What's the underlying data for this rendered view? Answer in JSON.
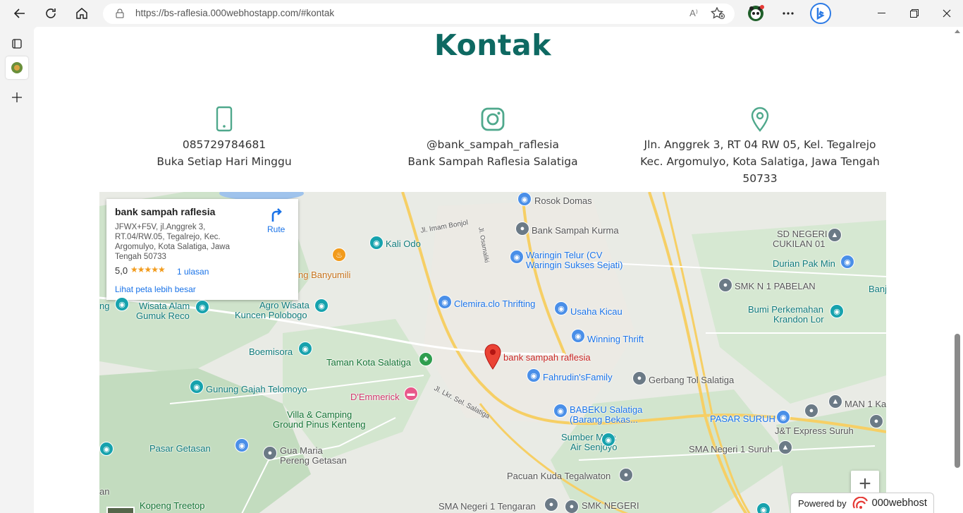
{
  "browser": {
    "url": "https://bs-raflesia.000webhostapp.com/#kontak",
    "read_aloud_label": "A⁾"
  },
  "page": {
    "title": "Kontak",
    "contacts": [
      {
        "icon": "phone-icon",
        "line1": "085729784681",
        "line2": "Buka Setiap Hari Minggu"
      },
      {
        "icon": "instagram-icon",
        "line1": "@bank_sampah_raflesia",
        "line2": "Bank Sampah Raflesia Salatiga"
      },
      {
        "icon": "location-pin-icon",
        "line1": "Jln. Anggrek 3, RT 04 RW 05, Kel. Tegalrejo",
        "line2": "Kec. Argomulyo, Kota Salatiga, Jawa Tengah 50733"
      }
    ],
    "accent_color": "#0e6962",
    "icon_color": "#4fa88c"
  },
  "map": {
    "card": {
      "name": "bank sampah raflesia",
      "address": "JFWX+F5V, jl.Anggrek 3, RT.04/RW.05, Tegalrejo, Kec. Argomulyo, Kota Salatiga, Jawa Tengah 50733",
      "rating": "5,0",
      "stars": "★★★★★",
      "reviews": "1 ulasan",
      "larger_map": "Lihat peta lebih besar",
      "directions": "Rute"
    },
    "marker_label": "bank sampah raflesia",
    "places": {
      "rosok_domas": "Rosok Domas",
      "bank_sampah_kurma": "Bank Sampah Kurma",
      "jl_imam_bonjol": "Jl. Imam Bonjol",
      "kali_odo": "Kali Odo",
      "waringin_telur_1": "Waringin Telur (CV",
      "waringin_telur_2": "Waringin Sukses Sejati)",
      "sd_negeri_1": "SD NEGERI",
      "sd_negeri_2": "CUKILAN 01",
      "durian_pak_min": "Durian Pak Min",
      "banj": "Banj",
      "smk_pabelan": "SMK N 1 PABELAN",
      "banyumili": "ng Banyumili",
      "wisata_alam_1": "Wisata Alam",
      "wisata_alam_2": "Gumuk Reco",
      "ng": "ng",
      "agro_wisata_1": "Agro Wisata",
      "agro_wisata_2": "Kuncen Polobogo",
      "clemira": "Clemira.clo Thrifting",
      "usaha_kicau": "Usaha Kicau",
      "bumi_1": "Bumi Perkemahan",
      "bumi_2": "Krandon Lor",
      "winning_thrift": "Winning Thrift",
      "boemisora": "Boemisora",
      "taman_kota": "Taman Kota Salatiga",
      "fahrudin": "Fahrudin'sFamily",
      "gerbang_tol": "Gerbang Tol Salatiga",
      "gunung_gajah": "Gunung Gajah Telomoyo",
      "demmerick": "D'Emmerick",
      "babeku_1": "BABEKU Salatiga",
      "babeku_2": "(Barang Bekas...",
      "man1": "MAN 1 Ka",
      "pasar_suruh": "PASAR SURUH",
      "jt_express": "J&T Express Suruh",
      "villa_1": "Villa & Camping",
      "villa_2": "Ground Pinus Kenteng",
      "jl_lkr": "Jl. Lkr. Sel. Salatiga",
      "sumber_mata_1": "Sumber Mata",
      "sumber_mata_2": "Air Senjoyo",
      "pasar_getasan": "Pasar Getasan",
      "gua_maria_1": "Gua Maria",
      "gua_maria_2": "Pereng Getasan",
      "sma_suruh": "SMA Negeri 1 Suruh",
      "pacuan_kuda": "Pacuan Kuda Tegalwaton",
      "an": "an",
      "kopeng": "Kopeng Treetop",
      "sma_tengaran": "SMA Negeri 1 Tengaran",
      "smk_negeri": "SMK NEGERI",
      "jl_osamaliki": "Jl. Osamaliki"
    },
    "zoom_in": "+"
  },
  "footer": {
    "powered_by": "Powered by",
    "brand": "000webhost"
  }
}
